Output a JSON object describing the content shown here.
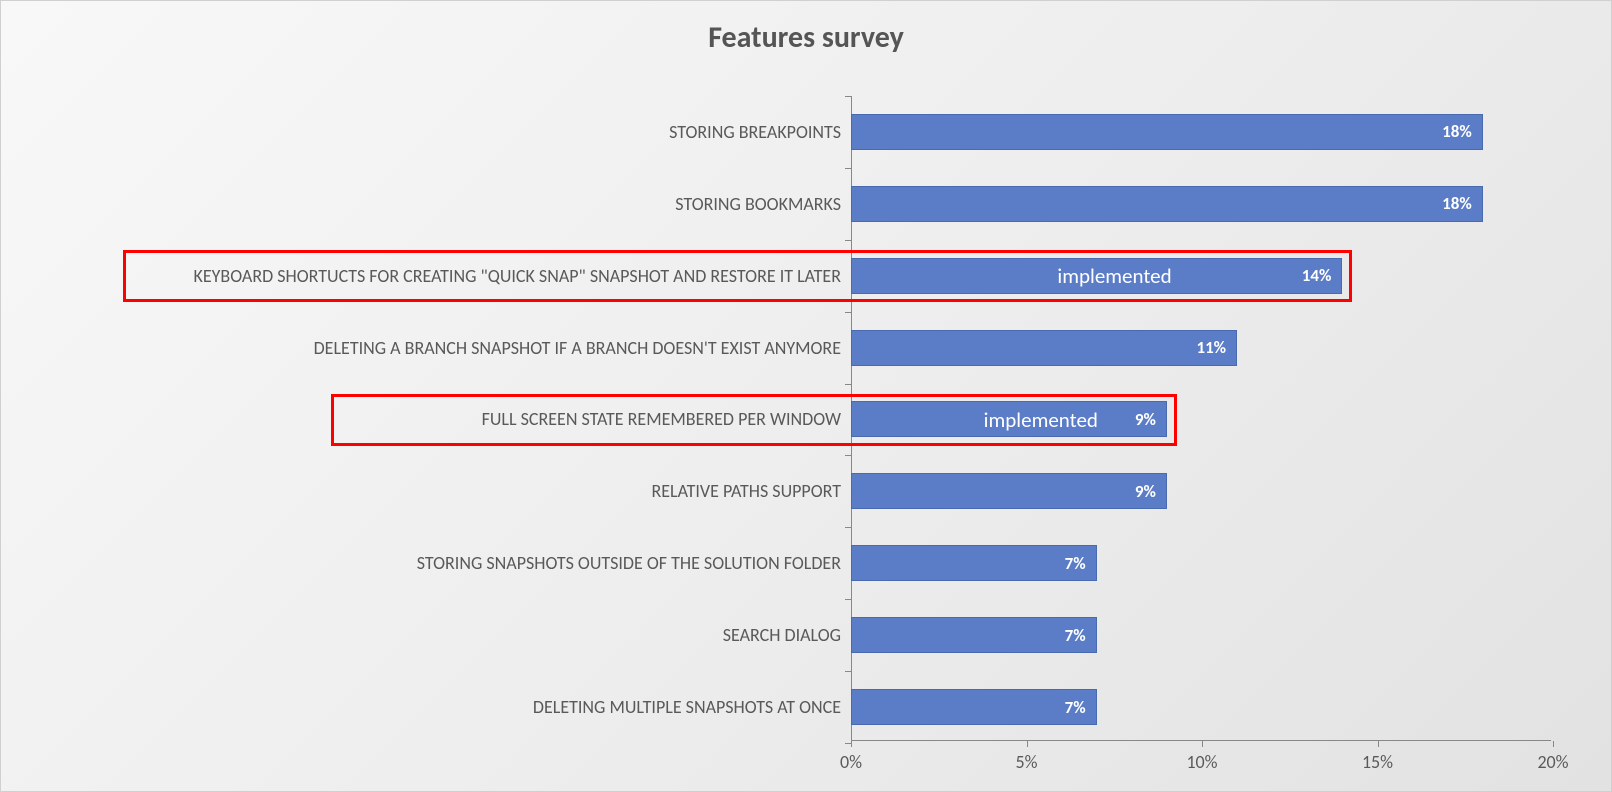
{
  "chart_data": {
    "type": "bar",
    "orientation": "horizontal",
    "title": "Features survey",
    "xlabel": "",
    "ylabel": "",
    "xlim": [
      0,
      20
    ],
    "x_ticks": [
      0,
      5,
      10,
      15,
      20
    ],
    "x_tick_labels": [
      "0%",
      "5%",
      "10%",
      "15%",
      "20%"
    ],
    "categories": [
      "STORING BREAKPOINTS",
      "STORING BOOKMARKS",
      "KEYBOARD SHORTUCTS FOR CREATING \"QUICK SNAP\" SNAPSHOT AND RESTORE IT LATER",
      "DELETING A BRANCH SNAPSHOT IF A BRANCH DOESN'T EXIST ANYMORE",
      "FULL SCREEN STATE REMEMBERED PER WINDOW",
      "RELATIVE PATHS SUPPORT",
      "STORING SNAPSHOTS OUTSIDE OF THE SOLUTION FOLDER",
      "SEARCH DIALOG",
      "DELETING MULTIPLE SNAPSHOTS AT ONCE"
    ],
    "values": [
      18,
      18,
      14,
      11,
      9,
      9,
      7,
      7,
      7
    ],
    "value_labels": [
      "18%",
      "18%",
      "14%",
      "11%",
      "9%",
      "9%",
      "7%",
      "7%",
      "7%"
    ],
    "annotations": [
      {
        "category_index": 2,
        "text": "implemented",
        "highlight": true
      },
      {
        "category_index": 4,
        "text": "implemented",
        "highlight": true
      }
    ],
    "bar_color": "#5B7CC6"
  }
}
